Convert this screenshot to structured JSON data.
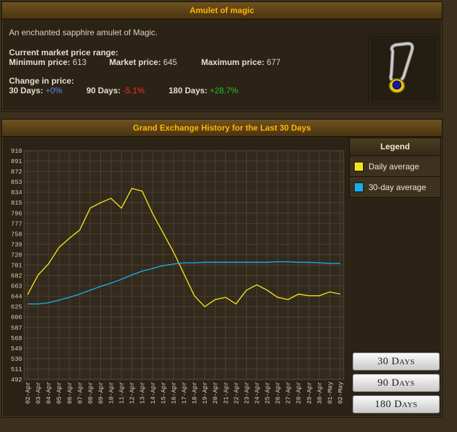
{
  "item": {
    "title": "Amulet of magic",
    "description": "An enchanted sapphire amulet of Magic.",
    "price_range_label": "Current market price range:",
    "min_label": "Minimum price:",
    "min_value": "613",
    "market_label": "Market price:",
    "market_value": "645",
    "max_label": "Maximum price:",
    "max_value": "677",
    "change_label": "Change in price:",
    "d30_label": "30 Days:",
    "d30_value": "+0%",
    "d90_label": "90 Days:",
    "d90_value": "-5.1%",
    "d180_label": "180 Days:",
    "d180_value": "+28.7%",
    "icon": "amulet-icon"
  },
  "graph": {
    "title": "Grand Exchange History for the Last 30 Days"
  },
  "legend": {
    "title": "Legend",
    "items": [
      {
        "label": "Daily average",
        "color": "#f5e31a"
      },
      {
        "label": "30-day average",
        "color": "#1aaee8"
      }
    ]
  },
  "buttons": {
    "b30": "30 Days",
    "b90": "90 Days",
    "b180": "180 Days"
  },
  "colors": {
    "daily": "#f5e31a",
    "avg": "#1aaee8",
    "plot_bg": "#322a1d",
    "grid": "#4d4232"
  },
  "chart_data": {
    "type": "line",
    "title": "Grand Exchange History for the Last 30 Days",
    "yticks": [
      910,
      891,
      872,
      853,
      834,
      815,
      796,
      777,
      758,
      739,
      720,
      701,
      682,
      663,
      644,
      625,
      606,
      587,
      568,
      549,
      530,
      511,
      492
    ],
    "xticks": [
      "02-Apr",
      "03-Apr",
      "04-Apr",
      "05-Apr",
      "06-Apr",
      "07-Apr",
      "08-Apr",
      "09-Apr",
      "10-Apr",
      "11-Apr",
      "12-Apr",
      "13-Apr",
      "14-Apr",
      "15-Apr",
      "16-Apr",
      "17-Apr",
      "18-Apr",
      "19-Apr",
      "20-Apr",
      "21-Apr",
      "22-Apr",
      "23-Apr",
      "24-Apr",
      "25-Apr",
      "26-Apr",
      "27-Apr",
      "28-Apr",
      "29-Apr",
      "30-Apr",
      "01-May",
      "02-May"
    ],
    "ylim": [
      492,
      910
    ],
    "grid": true,
    "legend": "right",
    "series": [
      {
        "name": "Daily average",
        "color": "#f5e31a",
        "values": [
          647,
          683,
          703,
          733,
          750,
          765,
          805,
          815,
          823,
          805,
          841,
          836,
          795,
          760,
          725,
          685,
          645,
          625,
          638,
          642,
          630,
          655,
          665,
          655,
          642,
          638,
          648,
          645,
          645,
          652,
          648
        ]
      },
      {
        "name": "30-day average",
        "color": "#1aaee8",
        "values": [
          630,
          630,
          632,
          637,
          642,
          648,
          655,
          662,
          668,
          675,
          683,
          690,
          695,
          700,
          703,
          705,
          705,
          706,
          706,
          706,
          706,
          706,
          706,
          706,
          707,
          707,
          706,
          706,
          705,
          704,
          704
        ]
      }
    ]
  }
}
